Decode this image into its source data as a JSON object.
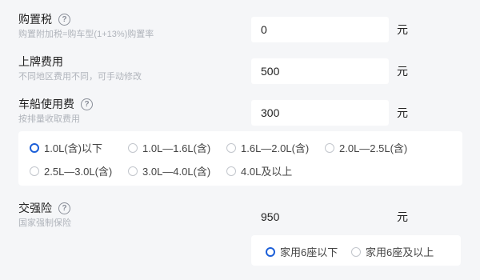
{
  "purchase_tax": {
    "title": "购置税",
    "subtitle": "购置附加税=购车型(1+13%)购置率",
    "value": "0",
    "unit": "元"
  },
  "license_fee": {
    "title": "上牌费用",
    "subtitle": "不同地区费用不同，可手动修改",
    "value": "500",
    "unit": "元"
  },
  "vehicle_tax": {
    "title": "车船使用费",
    "subtitle": "按排量收取费用",
    "value": "300",
    "unit": "元",
    "options": [
      {
        "label": "1.0L(含)以下",
        "checked": true
      },
      {
        "label": "1.0L—1.6L(含)",
        "checked": false
      },
      {
        "label": "1.6L—2.0L(含)",
        "checked": false
      },
      {
        "label": "2.0L—2.5L(含)",
        "checked": false
      },
      {
        "label": "2.5L—3.0L(含)",
        "checked": false
      },
      {
        "label": "3.0L—4.0L(含)",
        "checked": false
      },
      {
        "label": "4.0L及以上",
        "checked": false
      }
    ]
  },
  "compulsory_insurance": {
    "title": "交强险",
    "subtitle": "国家强制保险",
    "value": "950",
    "unit": "元",
    "options": [
      {
        "label": "家用6座以下",
        "checked": true
      },
      {
        "label": "家用6座及以上",
        "checked": false
      }
    ]
  },
  "help_icon_glyph": "?",
  "colors": {
    "accent": "#1c5fd8",
    "background": "#f5f6f8",
    "input_bg": "#ffffff",
    "subtitle_text": "#b0b4bb"
  }
}
